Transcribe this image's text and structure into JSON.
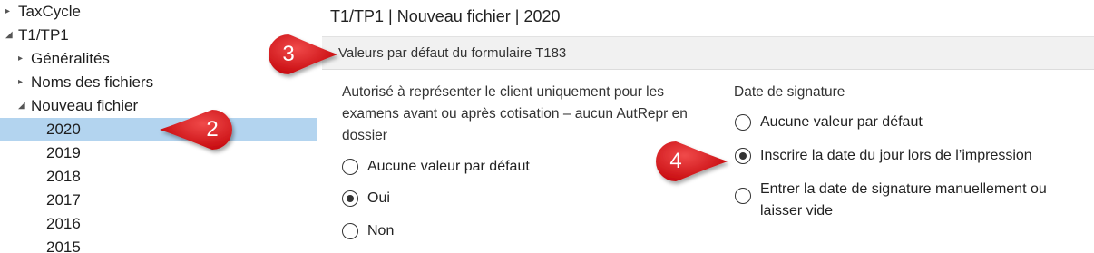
{
  "tree": {
    "items": [
      {
        "label": "TaxCycle",
        "expander": "▸"
      },
      {
        "label": "T1/TP1",
        "expander": "◢"
      },
      {
        "label": "Généralités",
        "expander": "▸"
      },
      {
        "label": "Noms des fichiers",
        "expander": "▸"
      },
      {
        "label": "Nouveau fichier",
        "expander": "◢"
      },
      {
        "label": "2020",
        "expander": ""
      },
      {
        "label": "2019",
        "expander": ""
      },
      {
        "label": "2018",
        "expander": ""
      },
      {
        "label": "2017",
        "expander": ""
      },
      {
        "label": "2016",
        "expander": ""
      },
      {
        "label": "2015",
        "expander": ""
      }
    ],
    "selected_label": "2020"
  },
  "panel": {
    "title": "T1/TP1 | Nouveau fichier | 2020",
    "section_title": "Valeurs par défaut du formulaire T183",
    "left_group": {
      "label": "Autorisé à représenter le client uniquement pour les examens avant ou après cotisation – aucun AutRepr en dossier",
      "options": [
        "Aucune valeur par défaut",
        "Oui",
        "Non"
      ],
      "selected": "Oui"
    },
    "right_group": {
      "label": "Date de signature",
      "options": [
        "Aucune valeur par défaut",
        "Inscrire la date du jour lors de l’impression",
        "Entrer la date de signature manuellement ou laisser vide"
      ],
      "selected": "Inscrire la date du jour lors de l’impression"
    }
  },
  "callouts": [
    "3",
    "2",
    "4"
  ],
  "colors": {
    "selection": "#b3d4ef",
    "callout_red": "#d9161c",
    "section_bar": "#f1f1f1"
  }
}
